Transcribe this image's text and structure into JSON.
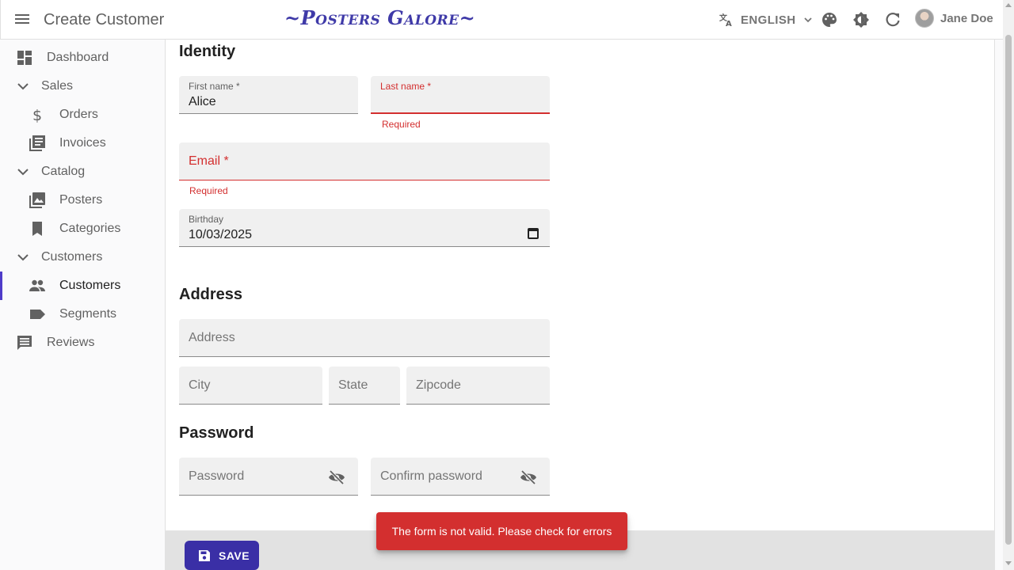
{
  "header": {
    "title": "Create Customer",
    "brand": "~Posters Galore~",
    "language": "ENGLISH",
    "user_name": "Jane Doe",
    "icons": [
      "menu-icon",
      "translate-icon",
      "palette-icon",
      "brightness-icon",
      "refresh-icon"
    ]
  },
  "sidebar": {
    "items": [
      {
        "label": "Dashboard",
        "icon": "dashboard-icon"
      },
      {
        "label": "Sales",
        "icon": "chevron-down-icon"
      },
      {
        "label": "Orders",
        "icon": "dollar-icon"
      },
      {
        "label": "Invoices",
        "icon": "invoices-icon"
      },
      {
        "label": "Catalog",
        "icon": "chevron-down-icon"
      },
      {
        "label": "Posters",
        "icon": "image-icon"
      },
      {
        "label": "Categories",
        "icon": "bookmark-icon"
      },
      {
        "label": "Customers",
        "icon": "chevron-down-icon"
      },
      {
        "label": "Customers",
        "icon": "people-icon",
        "active": true
      },
      {
        "label": "Segments",
        "icon": "label-icon"
      },
      {
        "label": "Reviews",
        "icon": "comment-icon"
      }
    ]
  },
  "form": {
    "identity_title": "Identity",
    "first_name": {
      "label": "First name *",
      "value": "Alice"
    },
    "last_name": {
      "label": "Last name *",
      "value": "",
      "helper": "Required"
    },
    "email": {
      "placeholder": "Email *",
      "helper": "Required"
    },
    "birthday": {
      "label": "Birthday",
      "value": "10/03/2025"
    },
    "address_title": "Address",
    "address": {
      "placeholder": "Address"
    },
    "city": {
      "placeholder": "City"
    },
    "state": {
      "placeholder": "State"
    },
    "zipcode": {
      "placeholder": "Zipcode"
    },
    "password_title": "Password",
    "password": {
      "placeholder": "Password"
    },
    "confirm_password": {
      "placeholder": "Confirm password"
    }
  },
  "toolbar": {
    "save_label": "SAVE"
  },
  "snackbar": {
    "message": "The form is not valid. Please check for errors"
  },
  "colors": {
    "accent": "#4f3cc9",
    "error": "#d32f2f",
    "save_button": "#3a2fa6",
    "brand": "#3f3aa8"
  }
}
